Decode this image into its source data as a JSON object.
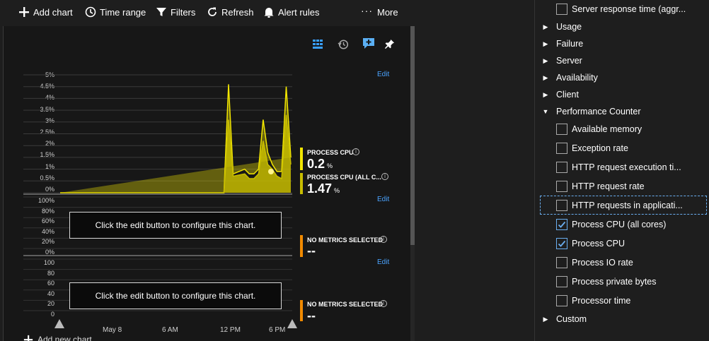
{
  "toolbar": {
    "add_chart": "Add chart",
    "time_range": "Time range",
    "filters": "Filters",
    "refresh": "Refresh",
    "alert_rules": "Alert rules",
    "more": "More"
  },
  "chart_panel": {
    "icons": [
      "grid-icon",
      "history-icon",
      "chat-add-icon",
      "pin-icon"
    ],
    "chart1": {
      "y_ticks": [
        "5%",
        "4.5%",
        "4%",
        "3.5%",
        "3%",
        "2.5%",
        "2%",
        "1.5%",
        "1%",
        "0.5%",
        "0%"
      ],
      "edit": "Edit",
      "metrics": [
        {
          "title": "PROCESS CPU",
          "value": "0.2",
          "unit": "%",
          "color": "#f2e600"
        },
        {
          "title": "PROCESS CPU (ALL C...",
          "value": "1.47",
          "unit": "%",
          "color": "#c8bd00"
        }
      ]
    },
    "chart2": {
      "y_ticks": [
        "100%",
        "80%",
        "60%",
        "40%",
        "20%",
        "0%"
      ],
      "edit": "Edit",
      "message": "Click the edit button to configure this chart.",
      "metric_title": "NO METRICS SELECTED",
      "metric_value": "--",
      "bar_color": "#f08a00"
    },
    "chart3": {
      "y_ticks": [
        "100",
        "80",
        "60",
        "40",
        "20",
        "0"
      ],
      "message": "Click the edit button to configure this chart.",
      "metric_title": "NO METRICS SELECTED",
      "metric_value": "--",
      "bar_color": "#f08a00"
    },
    "x_ticks": [
      "May 8",
      "6 AM",
      "12 PM",
      "6 PM"
    ],
    "add_new_chart": "Add new chart"
  },
  "chart_data": {
    "type": "area",
    "x": [
      "May 8",
      "6 AM",
      "12 PM",
      "6 PM"
    ],
    "ylim": [
      0,
      5
    ],
    "ylabel": "",
    "series": [
      {
        "name": "PROCESS CPU",
        "color": "#f2e600",
        "style": "line",
        "t": [
          0,
          0.2,
          0.4,
          0.6,
          0.71,
          0.73,
          0.75,
          0.8,
          0.82,
          0.84,
          0.86,
          0.88,
          0.9,
          0.92,
          0.94,
          0.96,
          0.98,
          1.0
        ],
        "values": [
          0,
          0,
          0,
          0,
          0,
          4.6,
          0.8,
          1.0,
          0.8,
          0.8,
          1.0,
          3.1,
          1.7,
          1.2,
          0.9,
          0.9,
          4.5,
          1.5
        ]
      },
      {
        "name": "PROCESS CPU (ALL C...",
        "color": "#c8bd00",
        "style": "area",
        "t": [
          0,
          0.2,
          0.4,
          0.6,
          0.71,
          0.73,
          0.75,
          0.8,
          0.82,
          0.84,
          0.86,
          0.88,
          0.9,
          0.92,
          0.94,
          0.96,
          0.98,
          1.0
        ],
        "values": [
          0,
          0,
          0,
          0,
          0,
          3.1,
          0.7,
          0.8,
          0.6,
          0.6,
          0.8,
          2.2,
          1.2,
          1.0,
          0.7,
          0.6,
          3.3,
          1.2
        ]
      }
    ]
  },
  "right_panel": {
    "top_item": "Server response time (aggr...",
    "groups": [
      "Usage",
      "Failure",
      "Server",
      "Availability",
      "Client"
    ],
    "expanded_group": "Performance Counter",
    "counters": [
      {
        "label": "Available memory",
        "checked": false
      },
      {
        "label": "Exception rate",
        "checked": false
      },
      {
        "label": "HTTP request execution ti...",
        "checked": false
      },
      {
        "label": "HTTP request rate",
        "checked": false
      },
      {
        "label": "HTTP requests in applicati...",
        "checked": false,
        "focused": true
      },
      {
        "label": "Process CPU (all cores)",
        "checked": true
      },
      {
        "label": "Process CPU",
        "checked": true
      },
      {
        "label": "Process IO rate",
        "checked": false
      },
      {
        "label": "Process private bytes",
        "checked": false
      },
      {
        "label": "Processor time",
        "checked": false
      }
    ],
    "last_group": "Custom"
  }
}
